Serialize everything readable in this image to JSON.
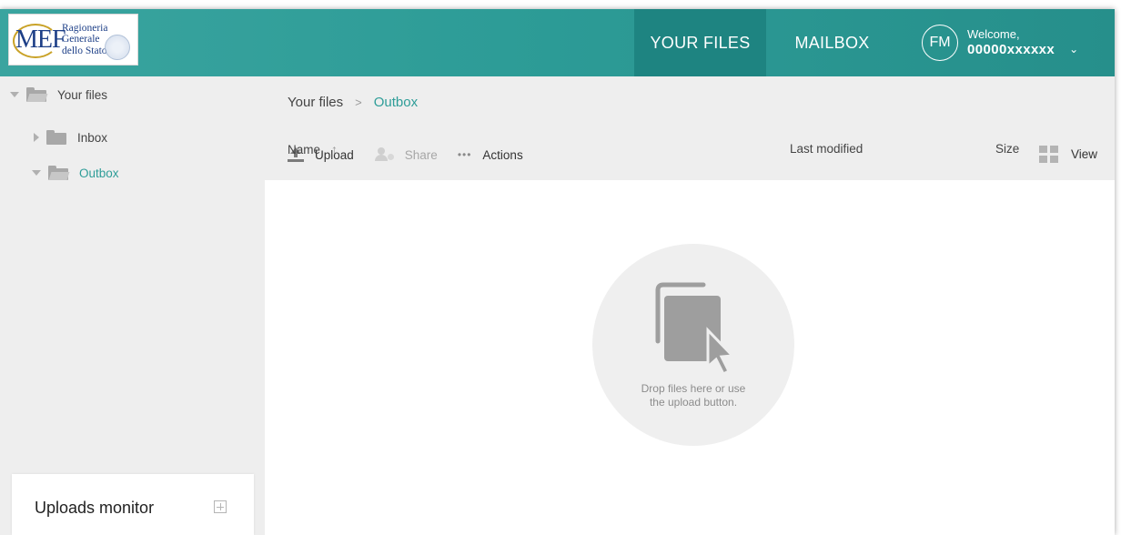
{
  "header": {
    "logo": {
      "mark": "MEF",
      "lines": [
        "Ragioneria",
        "Generale",
        "dello Stato"
      ]
    },
    "nav": [
      {
        "label": "YOUR FILES",
        "active": true
      },
      {
        "label": "MAILBOX",
        "active": false
      }
    ],
    "user": {
      "initials": "FM",
      "welcome": "Welcome,",
      "username": "00000xxxxxx",
      "menu_icon": "chevron-down-icon"
    }
  },
  "sidebar": {
    "tree": {
      "root": {
        "label": "Your files",
        "expanded": true,
        "icon": "folder-open-icon"
      },
      "children": [
        {
          "label": "Inbox",
          "expanded": false,
          "selected": false,
          "icon": "folder-icon"
        },
        {
          "label": "Outbox",
          "expanded": true,
          "selected": true,
          "icon": "folder-open-icon"
        }
      ]
    },
    "uploads_monitor": {
      "title": "Uploads monitor",
      "icon": "expand-icon"
    }
  },
  "main": {
    "breadcrumb": {
      "root": "Your files",
      "separator": ">",
      "current": "Outbox"
    },
    "toolbar": {
      "upload": "Upload",
      "share": "Share",
      "actions_dots": "•••",
      "actions": "Actions",
      "view": "View"
    },
    "columns": {
      "name": "Name",
      "sort_icon": "↑",
      "last_modified": "Last modified",
      "size": "Size"
    },
    "empty_state": {
      "text_line1": "Drop files here or use",
      "text_line2": "the upload button."
    }
  },
  "colors": {
    "header_teal": "#2d9c97",
    "active_tab": "#1e8481",
    "accent_text": "#2e9d98",
    "panel_gray": "#eeeeee"
  }
}
